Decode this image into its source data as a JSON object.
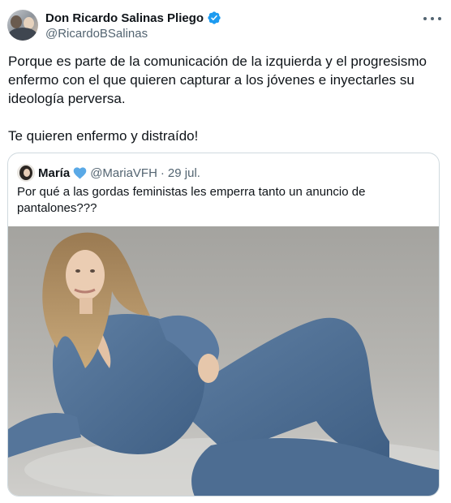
{
  "author": {
    "display_name": "Don Ricardo Salinas Pliego",
    "handle": "@RicardoBSalinas",
    "verified_icon": "verified-badge-icon",
    "avatar": "avatar"
  },
  "tweet": {
    "paragraph_1": "Porque es parte de la comunicación de la izquierda y el progresismo enfermo con el que quieren capturar a los jóvenes e inyectarles su ideología perversa.",
    "paragraph_2": "Te quieren enfermo y distraído!"
  },
  "quoted": {
    "display_name": "María",
    "heart_icon": "blue-heart-icon",
    "handle": "@MariaVFH",
    "separator": "·",
    "date": "29 jul.",
    "text": "Por qué a las gordas feministas les emperra tanto un anuncio de pantalones???"
  },
  "colors": {
    "text_primary": "#0f1419",
    "text_secondary": "#536471",
    "verified_blue": "#1d9bf0",
    "border": "#cfd9de",
    "heart_blue": "#5aa9e6"
  }
}
